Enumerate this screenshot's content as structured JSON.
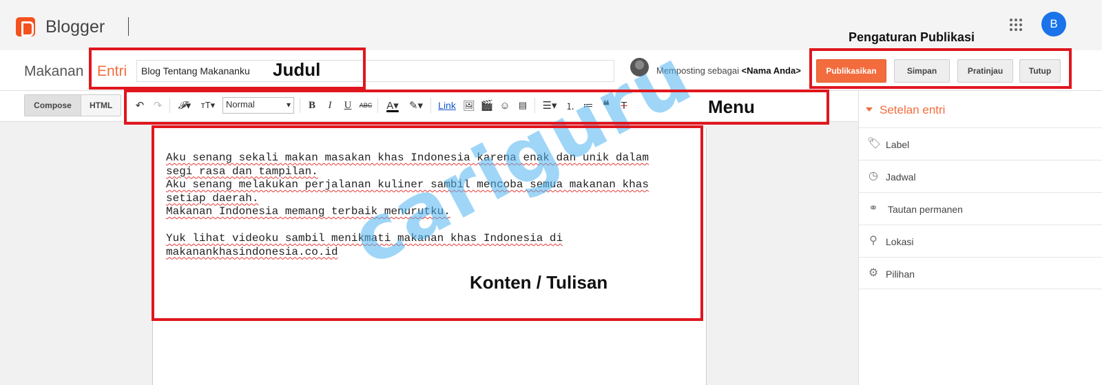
{
  "app": {
    "brand": "Blogger",
    "avatar_letter": "B"
  },
  "publish_settings_label": "Pengaturan Publikasi",
  "header": {
    "blog_name": "Makanan",
    "section": "Entri",
    "title_value": "Blog Tentang Makananku",
    "posting_as_prefix": "Memposting sebagai ",
    "posting_as_name": "<Nama Anda>",
    "buttons": {
      "publish": "Publikasikan",
      "save": "Simpan",
      "preview": "Pratinjau",
      "close": "Tutup"
    }
  },
  "toolbar": {
    "compose": "Compose",
    "html": "HTML",
    "format_select": "Normal",
    "link": "Link"
  },
  "editor": {
    "lines": [
      "Aku senang sekali makan masakan khas Indonesia karena enak dan unik dalam",
      "segi rasa dan tampilan.",
      "Aku senang melakukan perjalanan kuliner sambil mencoba semua makanan khas",
      "setiap daerah.",
      "Makanan Indonesia memang terbaik menurutku.",
      "",
      "Yuk lihat videoku sambil menikmati makanan khas Indonesia di",
      "makanankhasindonesia.co.id"
    ]
  },
  "sidebar": {
    "heading": "Setelan entri",
    "items": [
      {
        "label": "Label",
        "icon": "tag-icon"
      },
      {
        "label": "Jadwal",
        "icon": "clock-icon"
      },
      {
        "label": "Tautan permanen",
        "icon": "link-icon"
      },
      {
        "label": "Lokasi",
        "icon": "location-pin-icon"
      },
      {
        "label": "Pilihan",
        "icon": "gear-icon"
      }
    ]
  },
  "annotations": {
    "judul": "Judul",
    "menu": "Menu",
    "konten": "Konten / Tulisan"
  },
  "watermark": "cariguru",
  "colors": {
    "accent": "#f36c3d",
    "brand": "#f4511e",
    "annotation": "#e0161e",
    "avatar": "#1a73e8"
  }
}
